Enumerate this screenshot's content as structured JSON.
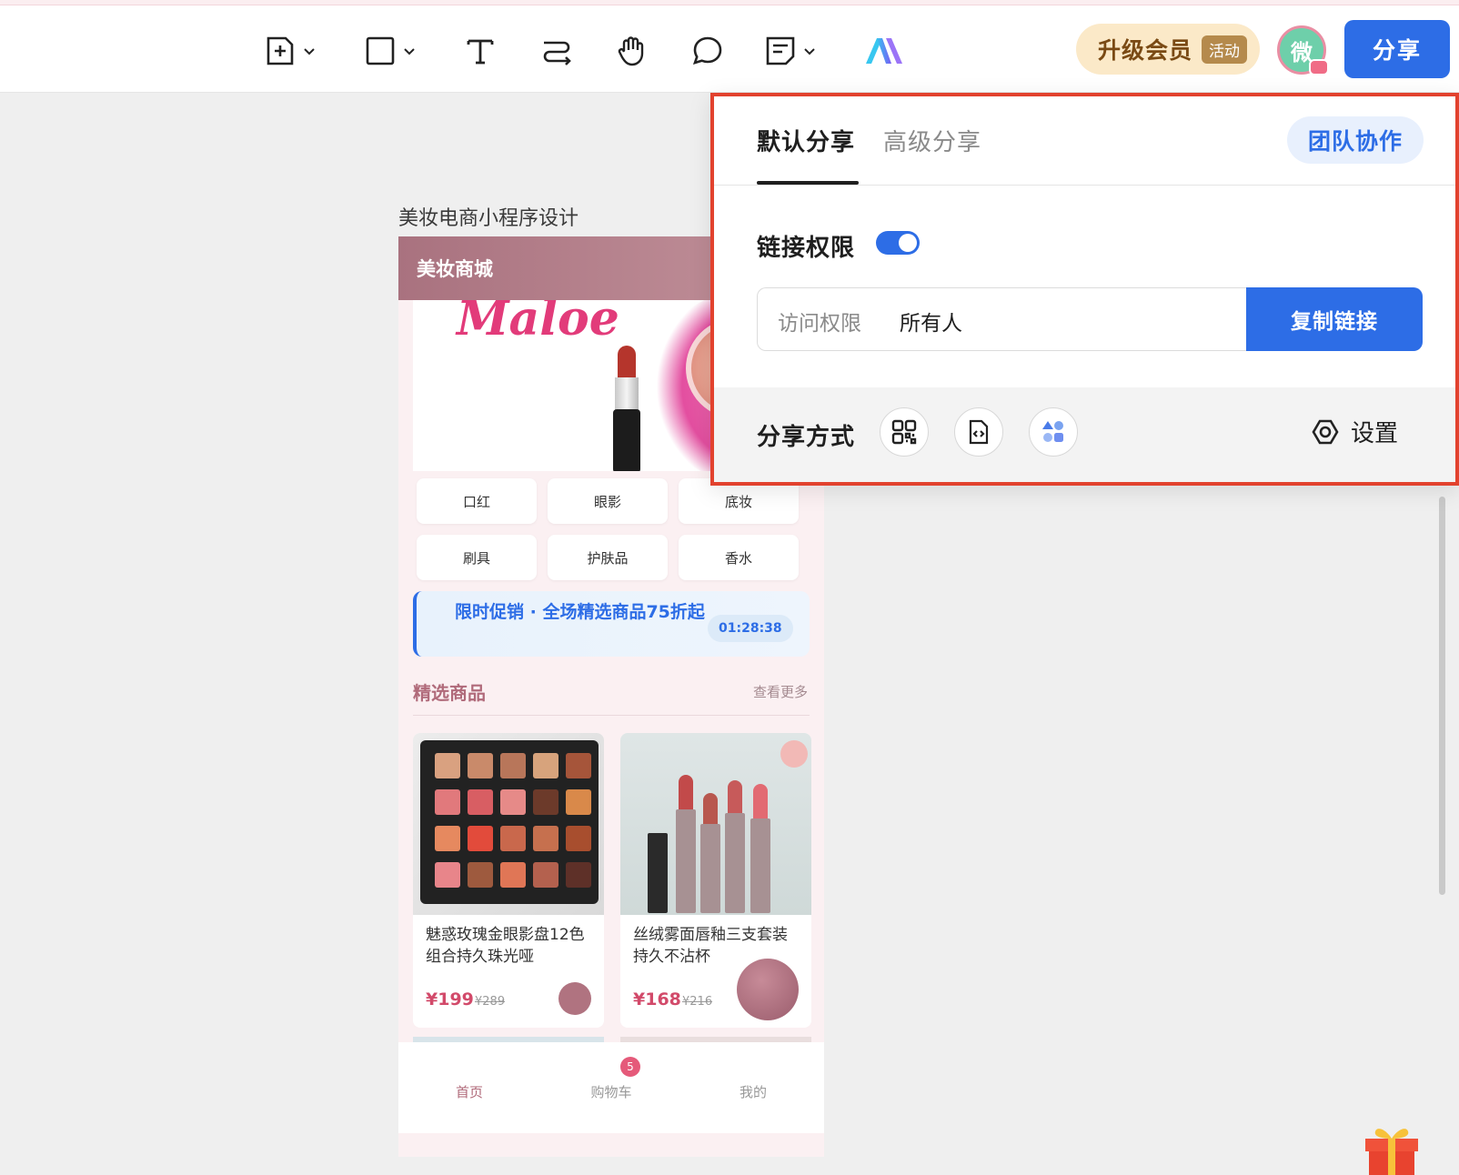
{
  "toolbar": {
    "tools": [
      {
        "icon": "add-frame-icon"
      },
      {
        "icon": "rectangle-icon"
      },
      {
        "icon": "text-icon"
      },
      {
        "icon": "connector-icon"
      },
      {
        "icon": "hand-icon"
      },
      {
        "icon": "comment-icon"
      },
      {
        "icon": "note-icon"
      },
      {
        "icon": "ai-logo-icon"
      }
    ],
    "upgrade_label": "升级会员",
    "upgrade_badge": "活动",
    "avatar_text": "微",
    "share_label": "分享"
  },
  "canvas": {
    "frame_title": "美妆电商小程序设计",
    "app": {
      "header_title": "美妆商城",
      "banner_brand": "Maloe",
      "categories": [
        "口红",
        "眼影",
        "底妆",
        "刷具",
        "护肤品",
        "香水"
      ],
      "promo_text": "限时促销 · 全场精选商品75折起",
      "promo_timer": "01:28:38",
      "section_title": "精选商品",
      "section_more": "查看更多",
      "products": [
        {
          "name": "魅惑玫瑰金眼影盘12色组合持久珠光哑",
          "price": "¥199",
          "old_price": "¥289"
        },
        {
          "name": "丝绒雾面唇釉三支套装 持久不沾杯",
          "price": "¥168",
          "old_price": "¥216"
        }
      ],
      "tabs": [
        {
          "label": "首页",
          "active": true
        },
        {
          "label": "购物车",
          "badge": "5"
        },
        {
          "label": "我的"
        }
      ]
    }
  },
  "share_panel": {
    "tabs": [
      {
        "label": "默认分享",
        "active": true
      },
      {
        "label": "高级分享",
        "active": false
      }
    ],
    "team_button": "团队协作",
    "link_permission_label": "链接权限",
    "link_permission_enabled": true,
    "access_label": "访问权限",
    "access_value": "所有人",
    "copy_button": "复制链接",
    "share_methods_label": "分享方式",
    "share_methods": [
      "qr-code-icon",
      "embed-code-icon",
      "apps-icon"
    ],
    "settings_label": "设置"
  },
  "colors": {
    "accent": "#2d6de6",
    "highlight_border": "#e2422e",
    "app_header": "#b07a86"
  }
}
